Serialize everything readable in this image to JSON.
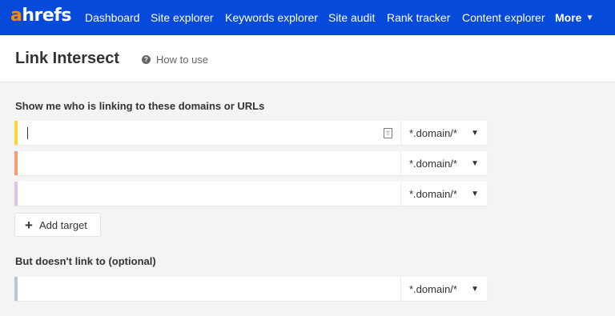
{
  "logo": {
    "first": "a",
    "rest": "hrefs"
  },
  "nav": {
    "items": [
      "Dashboard",
      "Site explorer",
      "Keywords explorer",
      "Site audit",
      "Rank tracker",
      "Content explorer"
    ],
    "more": "More"
  },
  "header": {
    "title": "Link Intersect",
    "help": "How to use"
  },
  "targets_section": {
    "label": "Show me who is linking to these domains or URLs"
  },
  "targets": [
    {
      "value": "",
      "mode": "*.domain/*",
      "color": "#FFD333"
    },
    {
      "value": "",
      "mode": "*.domain/*",
      "color": "#FF9A73"
    },
    {
      "value": "",
      "mode": "*.domain/*",
      "color": "#E3C0EC"
    }
  ],
  "add_target": {
    "label": "Add target"
  },
  "exclude_section": {
    "label": "But doesn't link to (optional)"
  },
  "exclude": {
    "value": "",
    "mode": "*.domain/*",
    "color": "#B9C6D2"
  },
  "colors": {
    "topbar": "#054ADA",
    "logo_accent": "#FF8800"
  }
}
